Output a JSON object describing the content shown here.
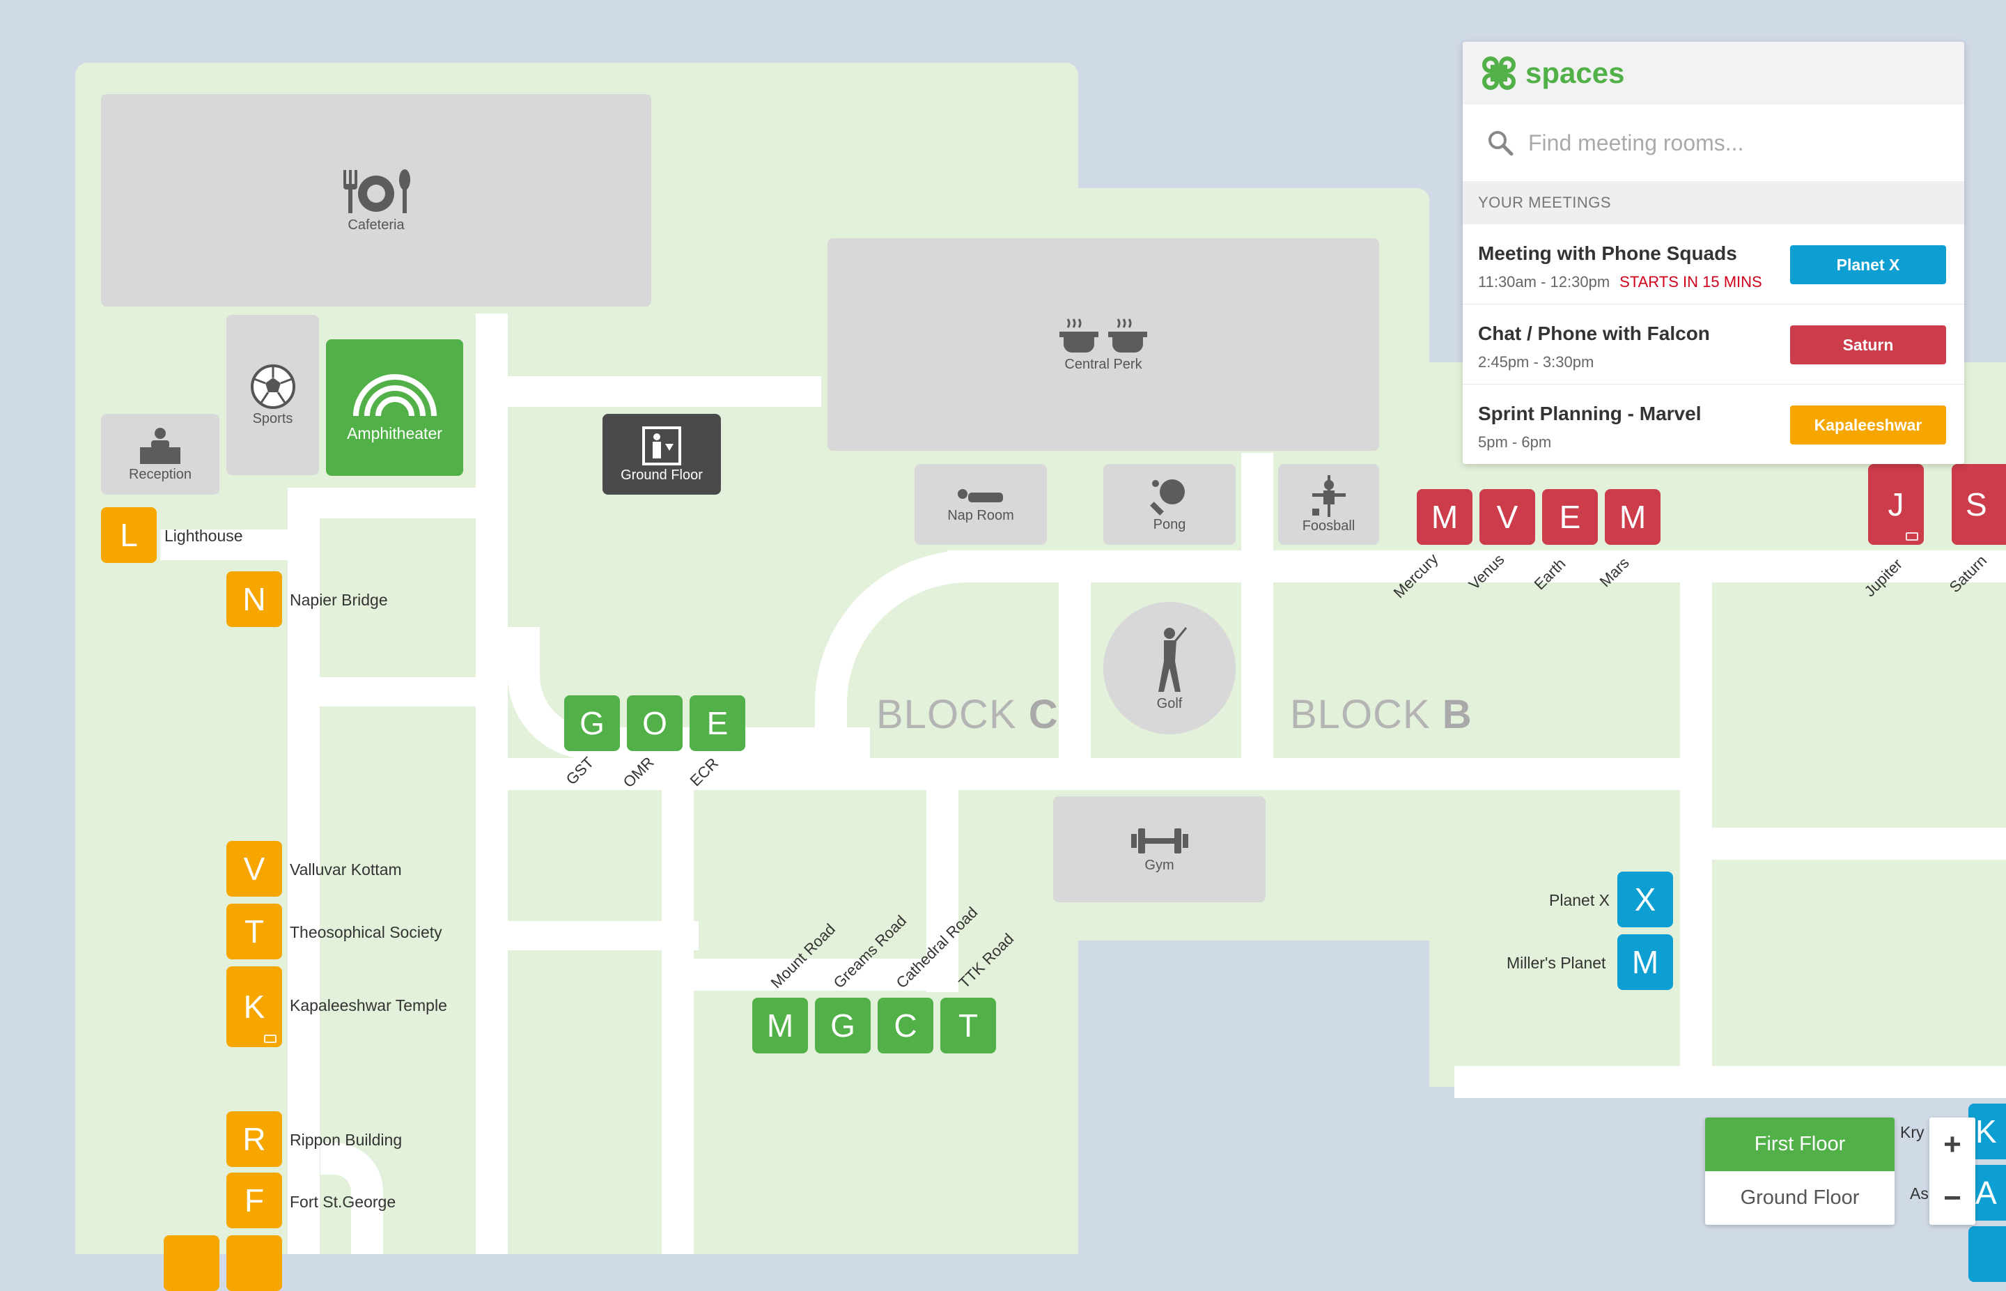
{
  "panel": {
    "brand": "spaces",
    "search_placeholder": "Find meeting rooms...",
    "section_title": "YOUR MEETINGS",
    "meetings": [
      {
        "title": "Meeting with Phone Squads",
        "time": "11:30am - 12:30pm",
        "alert": "STARTS IN 15 MINS",
        "room": "Planet X",
        "room_color": "#0e9fd2"
      },
      {
        "title": "Chat / Phone with Falcon",
        "time": "2:45pm - 3:30pm",
        "alert": "",
        "room": "Saturn",
        "room_color": "#cd3c4a"
      },
      {
        "title": "Sprint Planning - Marvel",
        "time": "5pm - 6pm",
        "alert": "",
        "room": "Kapaleeshwar",
        "room_color": "#f7a600"
      }
    ]
  },
  "facilities": {
    "cafeteria": "Cafeteria",
    "sports": "Sports",
    "amphitheater": "Amphitheater",
    "reception": "Reception",
    "ground_floor": "Ground Floor",
    "central_perk": "Central Perk",
    "nap_room": "Nap Room",
    "pong": "Pong",
    "foosball": "Foosball",
    "golf": "Golf",
    "gym": "Gym"
  },
  "blocks": {
    "c_prefix": "BLOCK",
    "c_letter": "C",
    "b_prefix": "BLOCK",
    "b_letter": "B"
  },
  "rooms_west": [
    {
      "letter": "L",
      "label": "Lighthouse"
    },
    {
      "letter": "N",
      "label": "Napier Bridge"
    },
    {
      "letter": "V",
      "label": "Valluvar Kottam"
    },
    {
      "letter": "T",
      "label": "Theosophical Society"
    },
    {
      "letter": "K",
      "label": "Kapaleeshwar Temple"
    },
    {
      "letter": "R",
      "label": "Rippon Building"
    },
    {
      "letter": "F",
      "label": "Fort St.George"
    }
  ],
  "rooms_goe": [
    {
      "letter": "G",
      "label": "GST"
    },
    {
      "letter": "O",
      "label": "OMR"
    },
    {
      "letter": "E",
      "label": "ECR"
    }
  ],
  "rooms_roads": [
    {
      "letter": "M",
      "label": "Mount Road"
    },
    {
      "letter": "G",
      "label": "Greams Road"
    },
    {
      "letter": "C",
      "label": "Cathedral Road"
    },
    {
      "letter": "T",
      "label": "TTK Road"
    }
  ],
  "rooms_planets": [
    {
      "letter": "M",
      "label": "Mercury"
    },
    {
      "letter": "V",
      "label": "Venus"
    },
    {
      "letter": "E",
      "label": "Earth"
    },
    {
      "letter": "M",
      "label": "Mars"
    },
    {
      "letter": "J",
      "label": "Jupiter"
    },
    {
      "letter": "S",
      "label": "Saturn"
    }
  ],
  "rooms_blue": [
    {
      "letter": "X",
      "label": "Planet X"
    },
    {
      "letter": "M",
      "label": "Miller's Planet"
    },
    {
      "letter": "K",
      "label": "Kry"
    },
    {
      "letter": "A",
      "label": "As"
    }
  ],
  "floor_switch": {
    "first": "First Floor",
    "ground": "Ground Floor",
    "active": "First Floor"
  },
  "zoom": {
    "in": "+",
    "out": "−"
  },
  "colors": {
    "orange": "#f7a600",
    "green": "#51b148",
    "red": "#cd3c4a",
    "blue": "#0e9fd2"
  }
}
